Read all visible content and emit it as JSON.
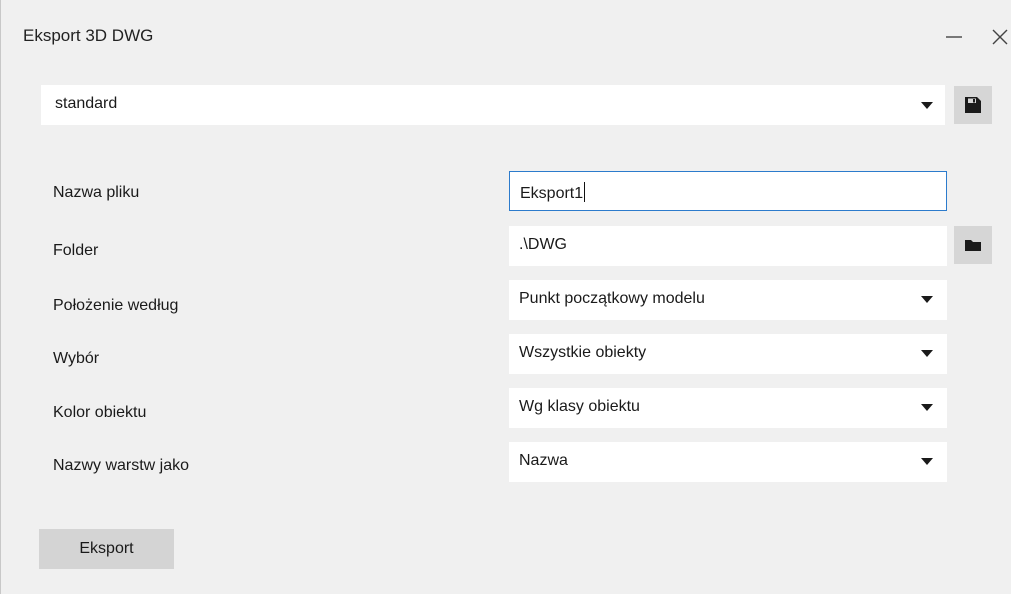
{
  "window": {
    "title": "Eksport 3D DWG",
    "minimize_icon": "minimize-icon",
    "close_icon": "close-icon"
  },
  "preset": {
    "value": "standard",
    "dropdown_icon": "chevron-down-icon",
    "save_icon": "floppy-disk-icon"
  },
  "form": {
    "file_name": {
      "label": "Nazwa pliku",
      "value": "Eksport1"
    },
    "folder": {
      "label": "Folder",
      "value": ".\\DWG",
      "browse_icon": "folder-icon"
    },
    "position": {
      "label": "Położenie według",
      "value": "Punkt początkowy modelu"
    },
    "selection": {
      "label": "Wybór",
      "value": "Wszystkie obiekty"
    },
    "object_color": {
      "label": "Kolor obiektu",
      "value": "Wg klasy obiektu"
    },
    "layer_names": {
      "label": "Nazwy warstw jako",
      "value": "Nazwa"
    }
  },
  "actions": {
    "export_label": "Eksport"
  },
  "colors": {
    "background": "#f0f0f0",
    "focus_border": "#2c7bcc",
    "button": "#d4d4d4"
  }
}
